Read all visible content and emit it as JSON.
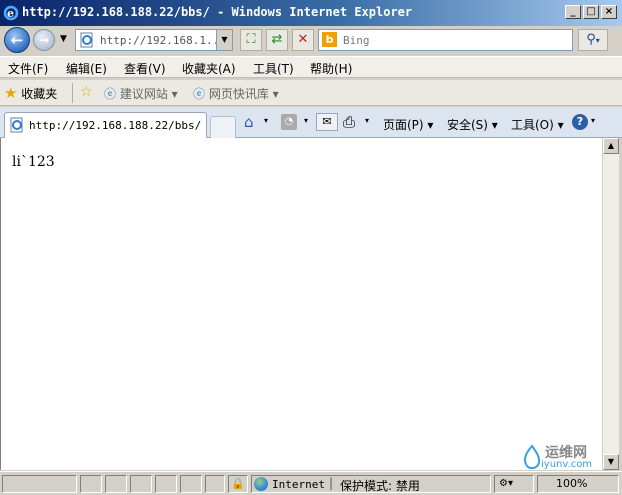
{
  "window": {
    "title": "http://192.168.188.22/bbs/ - Windows Internet Explorer",
    "min_glyph": "_",
    "max_glyph": "□",
    "close_glyph": "×"
  },
  "address": {
    "url": "http://192.168.1..."
  },
  "search": {
    "placeholder": "Bing"
  },
  "menu": {
    "items": [
      "文件(F)",
      "编辑(E)",
      "查看(V)",
      "收藏夹(A)",
      "工具(T)",
      "帮助(H)"
    ]
  },
  "favorites": {
    "label": "收藏夹",
    "suggested_sites": "建议网站 ▾",
    "web_slice": "网页快讯库 ▾"
  },
  "tab": {
    "title": "http://192.168.188.22/bbs/"
  },
  "commands": {
    "page": "页面(P) ▾",
    "safety": "安全(S) ▾",
    "tools": "工具(O) ▾"
  },
  "content": {
    "text": "li`123"
  },
  "status": {
    "zone": "Internet",
    "protected_mode": "保护模式: 禁用",
    "zoom": "100%"
  },
  "watermark": {
    "brand": "运维网",
    "domain": "iyunv.com"
  },
  "colors": {
    "titlebar_start": "#0a246a",
    "titlebar_end": "#a6caf0",
    "content_bg": "#ffffff",
    "chrome_bg": "#d4d0c8"
  }
}
